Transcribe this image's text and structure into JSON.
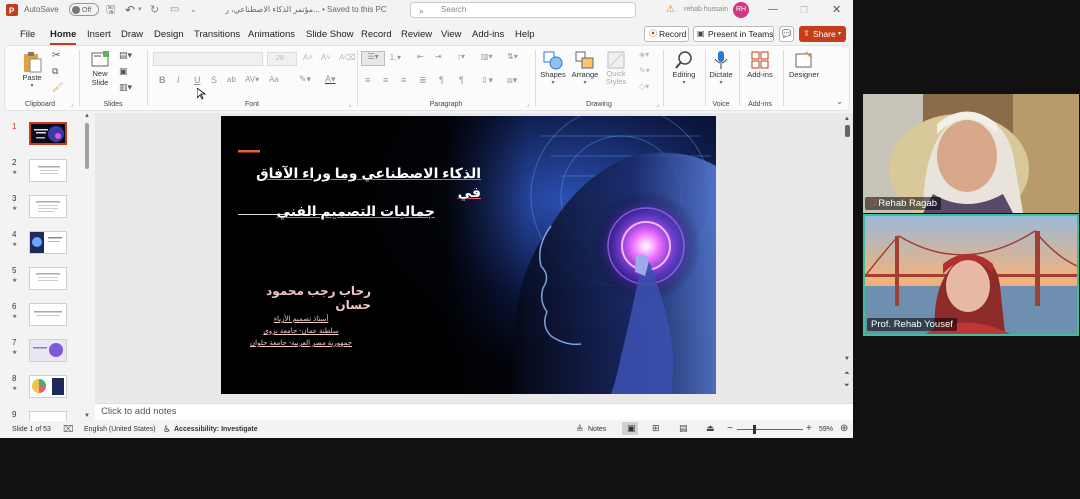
{
  "titlebar": {
    "autosave_label": "AutoSave",
    "autosave_state": "Off",
    "doc_title": "مؤتمر الذكاء الاصطناعي، ر... • Saved to this PC",
    "search_placeholder": "Search",
    "user_name": "rehab hussain",
    "user_initials": "RH"
  },
  "menu": {
    "tabs": [
      "File",
      "Home",
      "Insert",
      "Draw",
      "Design",
      "Transitions",
      "Animations",
      "Slide Show",
      "Record",
      "Review",
      "View",
      "Add-ins",
      "Help"
    ],
    "active_tab": "Home",
    "record_label": "Record",
    "present_teams_label": "Present in Teams",
    "share_label": "Share"
  },
  "ribbon": {
    "clipboard": {
      "group_label": "Clipboard",
      "paste_label": "Paste"
    },
    "slides": {
      "group_label": "Slides",
      "new_slide_label": "New Slide"
    },
    "font": {
      "group_label": "Font",
      "size_value": "28",
      "bold": "B",
      "italic": "I",
      "underline": "U",
      "strike": "S",
      "change_case": "Aa"
    },
    "paragraph": {
      "group_label": "Paragraph"
    },
    "drawing": {
      "group_label": "Drawing",
      "shapes_label": "Shapes",
      "arrange_label": "Arrange",
      "quick_styles_label": "Quick Styles"
    },
    "editing": {
      "editing_label": "Editing"
    },
    "voice": {
      "group_label": "Voice",
      "dictate_label": "Dictate"
    },
    "addins": {
      "group_label": "Add-ins",
      "addins_label": "Add-ins"
    },
    "designer": {
      "designer_label": "Designer"
    }
  },
  "thumbnails": [
    {
      "num": "1",
      "star": ""
    },
    {
      "num": "2",
      "star": "★"
    },
    {
      "num": "3",
      "star": "★"
    },
    {
      "num": "4",
      "star": "★"
    },
    {
      "num": "5",
      "star": "★"
    },
    {
      "num": "6",
      "star": "★"
    },
    {
      "num": "7",
      "star": "★"
    },
    {
      "num": "8",
      "star": "★"
    },
    {
      "num": "9",
      "star": "★"
    }
  ],
  "slide": {
    "title_line1": "الذكاء الاصطناعي وما وراء الآفاق في",
    "title_line2": "جماليات التصميم الفني",
    "author": "رحاب رجب محمود حسان",
    "role_line1": "أستاذ تصميم الأزياء",
    "role_line2": "سلطنة عمان- جامعة نزوى",
    "role_line3": "جمهورية مصر العربية- جامعة حلوان"
  },
  "notes_placeholder": "Click to add notes",
  "status": {
    "slide_counter": "Slide 1 of 53",
    "language": "English (United States)",
    "accessibility": "Accessibility: Investigate",
    "notes_label": "Notes",
    "zoom": "59%"
  },
  "participants": [
    {
      "name": "Rehab Ragab",
      "muted": true
    },
    {
      "name": "Prof. Rehab Yousef",
      "muted": false
    }
  ],
  "colors": {
    "accent": "#c43e1c",
    "active_speaker": "#3cc19a",
    "slide_title": "#ffffff",
    "slide_author": "#f2c7c7"
  }
}
